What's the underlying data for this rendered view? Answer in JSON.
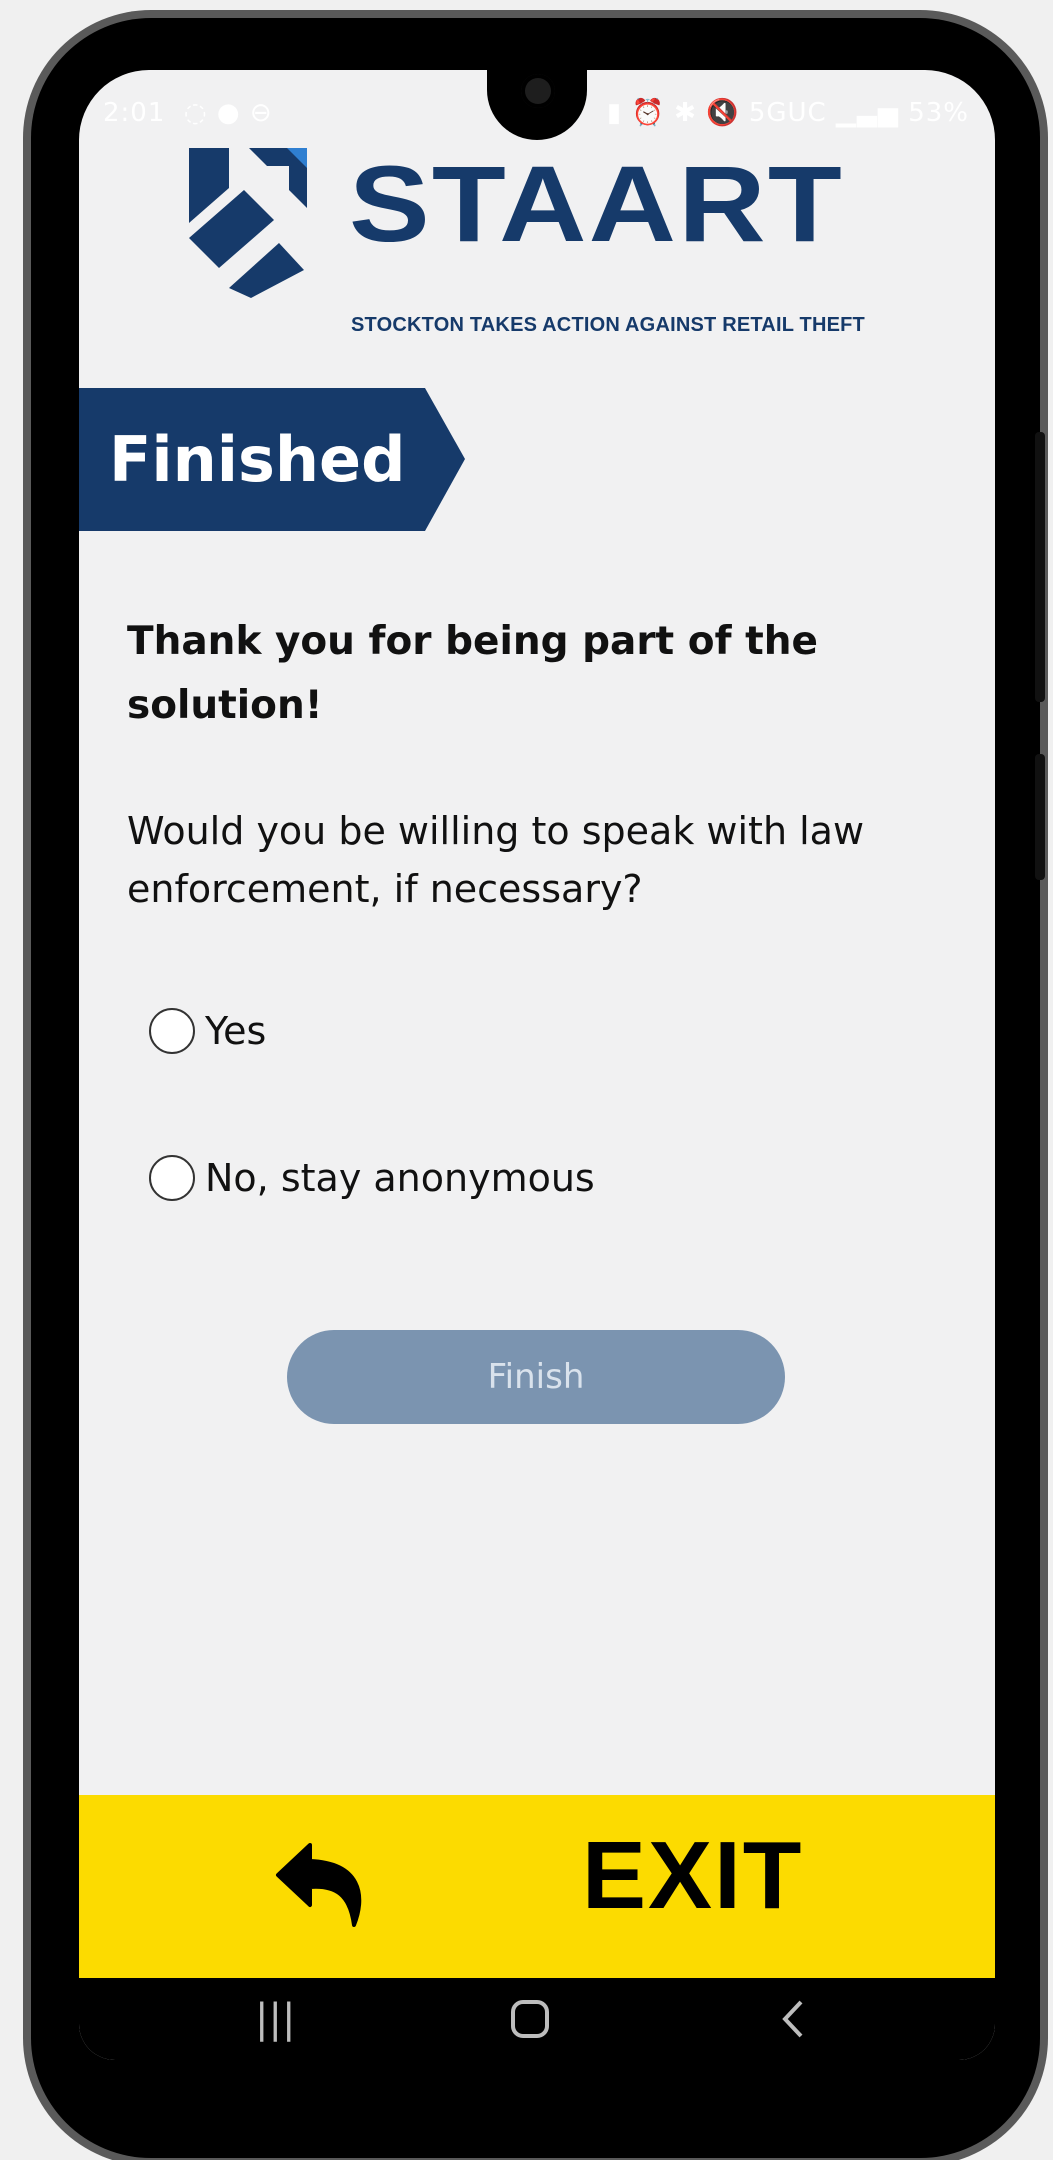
{
  "status_bar": {
    "time": "2:01",
    "network": "5GUC",
    "battery": "53%"
  },
  "logo": {
    "wordmark": "STAART",
    "tagline": "STOCKTON TAKES ACTION AGAINST RETAIL THEFT"
  },
  "banner": {
    "title": "Finished"
  },
  "content": {
    "heading": "Thank you for being part of the solution!",
    "question": "Would you be willing to speak with law enforcement, if necessary?",
    "options": [
      {
        "label": "Yes",
        "selected": false
      },
      {
        "label": "No, stay anonymous",
        "selected": false
      }
    ],
    "finish_label": "Finish"
  },
  "footer": {
    "back_icon": "reply-arrow-icon",
    "exit_label": "EXIT"
  },
  "colors": {
    "brand_navy": "#163a6a",
    "exit_yellow": "#fcdb00",
    "finish_disabled": "#7b94b0"
  }
}
